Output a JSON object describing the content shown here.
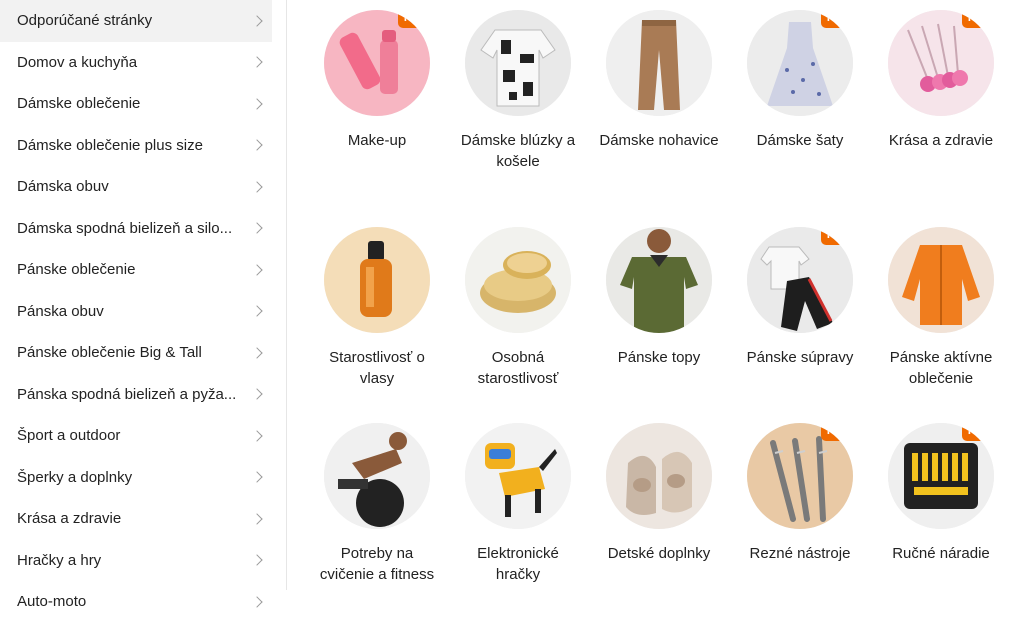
{
  "sidebar": {
    "items": [
      {
        "label": "Odporúčané stránky",
        "active": true
      },
      {
        "label": "Domov a kuchyňa"
      },
      {
        "label": "Dámske oblečenie"
      },
      {
        "label": "Dámske oblečenie plus size"
      },
      {
        "label": "Dámska obuv"
      },
      {
        "label": "Dámska spodná bielizeň a silo..."
      },
      {
        "label": "Pánske oblečenie"
      },
      {
        "label": "Pánska obuv"
      },
      {
        "label": "Pánske oblečenie Big & Tall"
      },
      {
        "label": "Pánska spodná bielizeň a pyža..."
      },
      {
        "label": "Šport a outdoor"
      },
      {
        "label": "Šperky a doplnky"
      },
      {
        "label": "Krása a zdravie"
      },
      {
        "label": "Hračky a hry"
      },
      {
        "label": "Auto-moto"
      }
    ]
  },
  "hot_badge_label": "HOT",
  "categories": [
    {
      "name": "Make-up",
      "hot": true
    },
    {
      "name": "Dámske blúzky a košele",
      "hot": false
    },
    {
      "name": "Dámske nohavice",
      "hot": false
    },
    {
      "name": "Dámske šaty",
      "hot": true
    },
    {
      "name": "Krása a zdravie",
      "hot": true
    },
    {
      "name": "Starostlivosť o vlasy",
      "hot": false
    },
    {
      "name": "Osobná starostlivosť",
      "hot": false
    },
    {
      "name": "Pánske topy",
      "hot": false
    },
    {
      "name": "Pánske súpravy",
      "hot": true
    },
    {
      "name": "Pánske aktívne oblečenie",
      "hot": false
    },
    {
      "name": "Potreby na cvičenie a fitness",
      "hot": false
    },
    {
      "name": "Elektronické hračky",
      "hot": false
    },
    {
      "name": "Detské doplnky",
      "hot": false
    },
    {
      "name": "Rezné nástroje",
      "hot": true
    },
    {
      "name": "Ručné náradie",
      "hot": true
    }
  ],
  "colors": {
    "hot_badge": "#f06a00",
    "active_bg": "#f2f2f2"
  }
}
